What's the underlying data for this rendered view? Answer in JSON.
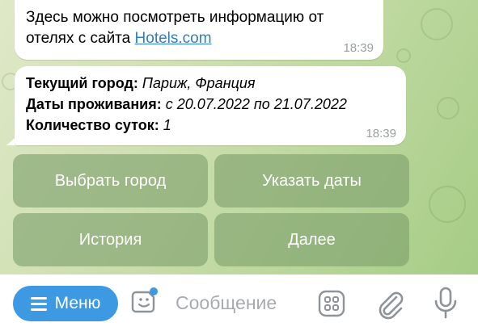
{
  "messages": [
    {
      "text_line1": "Здесь можно посмотреть информацию от",
      "text_line2_prefix": "отелях с сайта ",
      "link": "Hotels.com",
      "time": "18:39"
    },
    {
      "city_label": "Текущий город:",
      "city_value": "Париж, Франция",
      "dates_label": "Даты проживания:",
      "dates_value": "с 20.07.2022 по 21.07.2022",
      "nights_label": "Количество суток:",
      "nights_value": "1",
      "time": "18:39"
    }
  ],
  "keyboard": {
    "choose_city": "Выбрать город",
    "set_dates": "Указать даты",
    "history": "История",
    "next": "Далее"
  },
  "input_bar": {
    "menu_label": "Меню",
    "placeholder": "Сообщение"
  },
  "icons": {
    "sticker": "sticker-icon",
    "apps": "apps-icon",
    "attach": "paperclip-icon",
    "mic": "microphone-icon"
  },
  "colors": {
    "accent": "#3d9ae2",
    "link": "#2d7fc4",
    "keyboard_button": "#7ea06c",
    "notification_dot": "#3d9ae2"
  }
}
